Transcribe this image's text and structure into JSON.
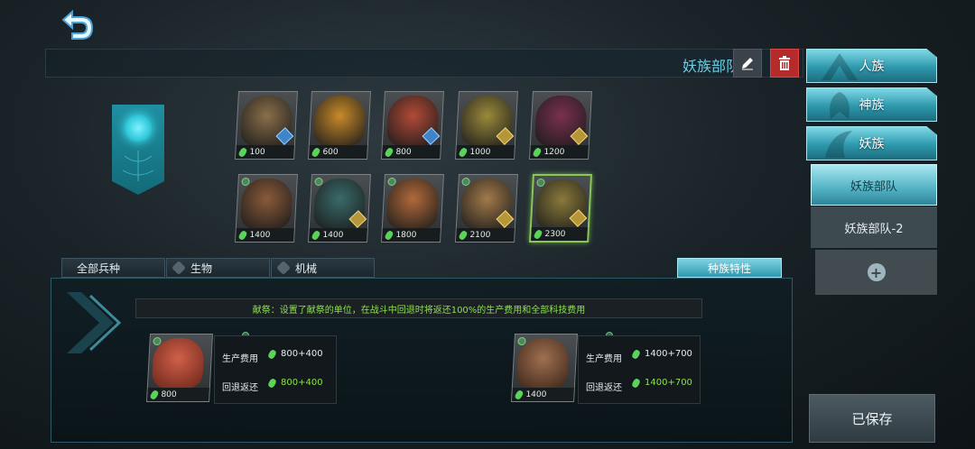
{
  "header": {
    "deck_title": "妖族部队"
  },
  "races": [
    {
      "label": "人族"
    },
    {
      "label": "神族"
    },
    {
      "label": "妖族"
    }
  ],
  "decks": [
    {
      "label": "妖族部队",
      "active": true
    },
    {
      "label": "妖族部队-2",
      "active": false
    }
  ],
  "saved_label": "已保存",
  "cards_row1": [
    {
      "cost": "100",
      "color": "#8a6f4a",
      "badge": "blue"
    },
    {
      "cost": "600",
      "color": "#c88a2a",
      "badge": "none"
    },
    {
      "cost": "800",
      "color": "#b24a36",
      "badge": "blue"
    },
    {
      "cost": "1000",
      "color": "#9a8a3a",
      "badge": "gold"
    },
    {
      "cost": "1200",
      "color": "#7a3050",
      "badge": "gold"
    }
  ],
  "cards_row2": [
    {
      "cost": "1400",
      "color": "#8a5a3a",
      "badge": "none"
    },
    {
      "cost": "1400",
      "color": "#3a6a6a",
      "badge": "gold"
    },
    {
      "cost": "1800",
      "color": "#b26a3a",
      "badge": "none"
    },
    {
      "cost": "2100",
      "color": "#a27a4a",
      "badge": "gold"
    },
    {
      "cost": "2300",
      "color": "#8a7a3a",
      "badge": "gold"
    }
  ],
  "filters": {
    "all": "全部兵种",
    "bio": "生物",
    "mech": "机械",
    "trait": "种族特性"
  },
  "sacrifice": {
    "text": "献祭：设置了献祭的单位，在战斗中回退时将返还100%的生产费用和全部科技费用",
    "slots": [
      {
        "card_cost": "800",
        "prod_label": "生产费用",
        "prod_value": "800+400",
        "refund_label": "回退返还",
        "refund_value": "800+400"
      },
      {
        "card_cost": "1400",
        "prod_label": "生产费用",
        "prod_value": "1400+700",
        "refund_label": "回退返还",
        "refund_value": "1400+700"
      }
    ]
  },
  "colors": {
    "accent": "#66cfe6",
    "green_text": "#8fe04f",
    "delete": "#b52a2a"
  }
}
